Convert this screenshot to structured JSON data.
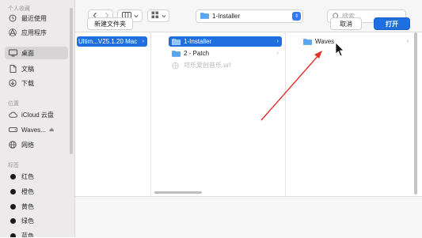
{
  "sidebar": {
    "sections": [
      {
        "heading": "个人收藏",
        "items": [
          {
            "label": "最近使用",
            "icon": "clock-icon"
          },
          {
            "label": "应用程序",
            "icon": "apps-icon"
          },
          {
            "label": "桌面",
            "icon": "desktop-icon",
            "selected": true
          },
          {
            "label": "文稿",
            "icon": "document-icon"
          },
          {
            "label": "下载",
            "icon": "download-icon"
          }
        ]
      },
      {
        "heading": "位置",
        "items": [
          {
            "label": "iCloud 云盘",
            "icon": "cloud-icon"
          },
          {
            "label": "Waves...",
            "icon": "drive-icon",
            "eject": "⏏"
          },
          {
            "label": "网络",
            "icon": "globe-icon"
          }
        ]
      },
      {
        "heading": "标签",
        "items": [
          {
            "label": "红色",
            "icon": "tag-dot-icon"
          },
          {
            "label": "橙色",
            "icon": "tag-dot-icon"
          },
          {
            "label": "黄色",
            "icon": "tag-dot-icon"
          },
          {
            "label": "绿色",
            "icon": "tag-dot-icon"
          },
          {
            "label": "蓝色",
            "icon": "tag-dot-icon"
          }
        ]
      }
    ]
  },
  "toolbar": {
    "back_icon": "chevron-left-icon",
    "forward_icon": "chevron-right-icon",
    "view_icon": "column-view-icon",
    "group_icon": "grid-icon",
    "path_label": "1-Installer",
    "search_placeholder": "搜索",
    "search_value": ""
  },
  "columns": [
    {
      "items": [
        {
          "label": "Ultim...V25.1.20 Mac",
          "selected": true,
          "has_children": true,
          "icon": "none"
        }
      ]
    },
    {
      "items": [
        {
          "label": "1-Installer",
          "selected": true,
          "has_children": true,
          "icon": "folder-icon"
        },
        {
          "label": "2 - Patch",
          "selected": false,
          "has_children": true,
          "icon": "folder-icon"
        },
        {
          "label": "可乐爱创音乐.url",
          "selected": false,
          "dimmed": true,
          "icon": "file-icon"
        }
      ]
    },
    {
      "items": [
        {
          "label": "Waves",
          "selected": false,
          "has_children": true,
          "icon": "folder-icon"
        }
      ]
    }
  ],
  "chevron": "›",
  "footer": {
    "new_folder_label": "新建文件夹",
    "cancel_label": "取消",
    "open_label": "打开"
  },
  "colors": {
    "accent": "#1f6fe0",
    "annotation": "#e0302a"
  }
}
